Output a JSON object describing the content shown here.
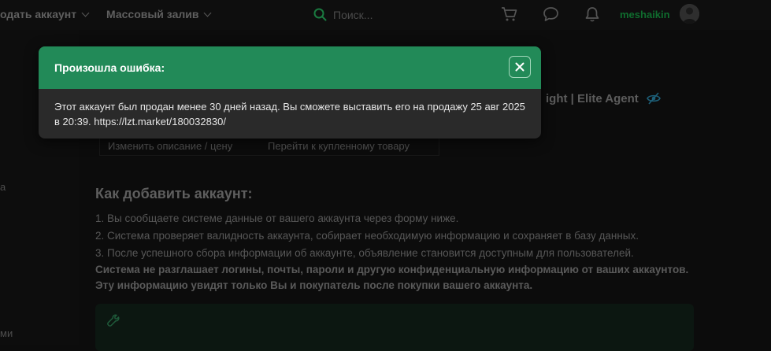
{
  "header": {
    "nav_sell": "одать аккаунт",
    "nav_mass_upload": "Массовый залив",
    "search_placeholder": "Поиск...",
    "username": "meshaikin",
    "icons": [
      "search-icon",
      "cart-icon",
      "chat-icon",
      "bell-icon"
    ]
  },
  "sidebar": {
    "label_1": "а",
    "label_2": "ми"
  },
  "page": {
    "title_fragment": "ight | Elite Agent",
    "actions": {
      "edit": "Изменить описание / цену",
      "go_to": "Перейти к купленному товару"
    },
    "heading": "Как добавить аккаунт:",
    "steps": [
      "1. Вы сообщаете системе данные от вашего аккаунта через форму ниже.",
      "2. Система проверяет валидность аккаунта, собирает необходимую информацию и сохраняет в базу данных.",
      "3. После успешного сбора информации об аккаунте, объявление становится доступным для пользователей."
    ],
    "privacy_note": "Система не разглашает логины, почты, пароли и другую конфиденциальную информацию от ваших аккаунтов. Эту информацию увидят только Вы и покупатель после покупки вашего аккаунта."
  },
  "modal": {
    "title": "Произошла ошибка:",
    "message": "Этот аккаунт был продан менее 30 дней назад. Вы сможете выставить его на продажу 25 авг 2025 в 20:39. https://lzt.market/180032830/",
    "close_symbol": "✕"
  },
  "colors": {
    "modal_header": "#228a58",
    "modal_body": "#2a2a2a",
    "username": "#0f6d2e",
    "page_bg": "#0c0c0c"
  }
}
